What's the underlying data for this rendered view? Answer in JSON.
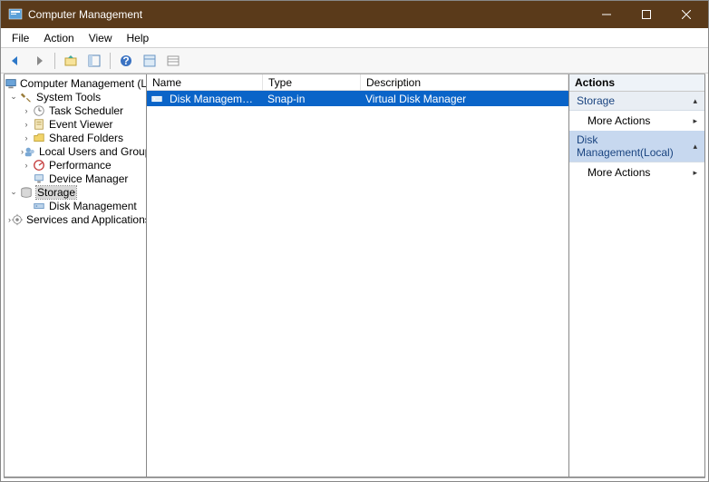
{
  "window": {
    "title": "Computer Management"
  },
  "menu": {
    "file": "File",
    "action": "Action",
    "view": "View",
    "help": "Help"
  },
  "tree": {
    "root": "Computer Management (Local)",
    "systools": "System Tools",
    "task_scheduler": "Task Scheduler",
    "event_viewer": "Event Viewer",
    "shared_folders": "Shared Folders",
    "local_users": "Local Users and Groups",
    "performance": "Performance",
    "device_manager": "Device Manager",
    "storage": "Storage",
    "disk_management": "Disk Management",
    "services_apps": "Services and Applications"
  },
  "list": {
    "columns": {
      "name": "Name",
      "type": "Type",
      "description": "Description"
    },
    "rows": [
      {
        "name": "Disk Management(Loc...",
        "type": "Snap-in",
        "description": "Virtual Disk Manager"
      }
    ]
  },
  "actions": {
    "title": "Actions",
    "groups": [
      {
        "label": "Storage",
        "links": [
          "More Actions"
        ]
      },
      {
        "label": "Disk Management(Local)",
        "links": [
          "More Actions"
        ]
      }
    ]
  }
}
